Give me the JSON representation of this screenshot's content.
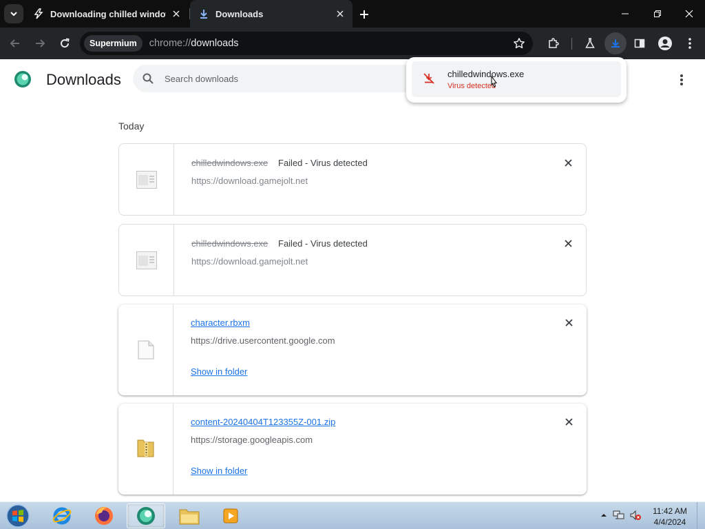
{
  "browser": {
    "tabs": [
      {
        "title": "Downloading chilled windows",
        "icon": "lightning-icon",
        "active": false
      },
      {
        "title": "Downloads",
        "icon": "download-icon",
        "active": true
      }
    ],
    "omnibox": {
      "chip": "Supermium",
      "url_prefix": "chrome://",
      "url_host": "downloads"
    }
  },
  "page": {
    "title": "Downloads",
    "search_placeholder": "Search downloads",
    "section": "Today"
  },
  "downloads": [
    {
      "name": "chilledwindows.exe",
      "status": "Failed - Virus detected",
      "source": "https://download.gamejolt.net",
      "state": "failed"
    },
    {
      "name": "chilledwindows.exe",
      "status": "Failed - Virus detected",
      "source": "https://download.gamejolt.net",
      "state": "failed"
    },
    {
      "name": "character.rbxm",
      "status": "",
      "source": "https://drive.usercontent.google.com",
      "action": "Show in folder",
      "state": "complete"
    },
    {
      "name": "content-20240404T123355Z-001.zip",
      "status": "",
      "source": "https://storage.googleapis.com",
      "action": "Show in folder",
      "state": "complete"
    }
  ],
  "bubble": {
    "name": "chilledwindows.exe",
    "status": "Virus detected"
  },
  "taskbar": {
    "time": "11:42 AM",
    "date": "4/4/2024"
  },
  "colors": {
    "error": "#d93025",
    "link": "#1a73e8",
    "toolbar": "#232629"
  }
}
